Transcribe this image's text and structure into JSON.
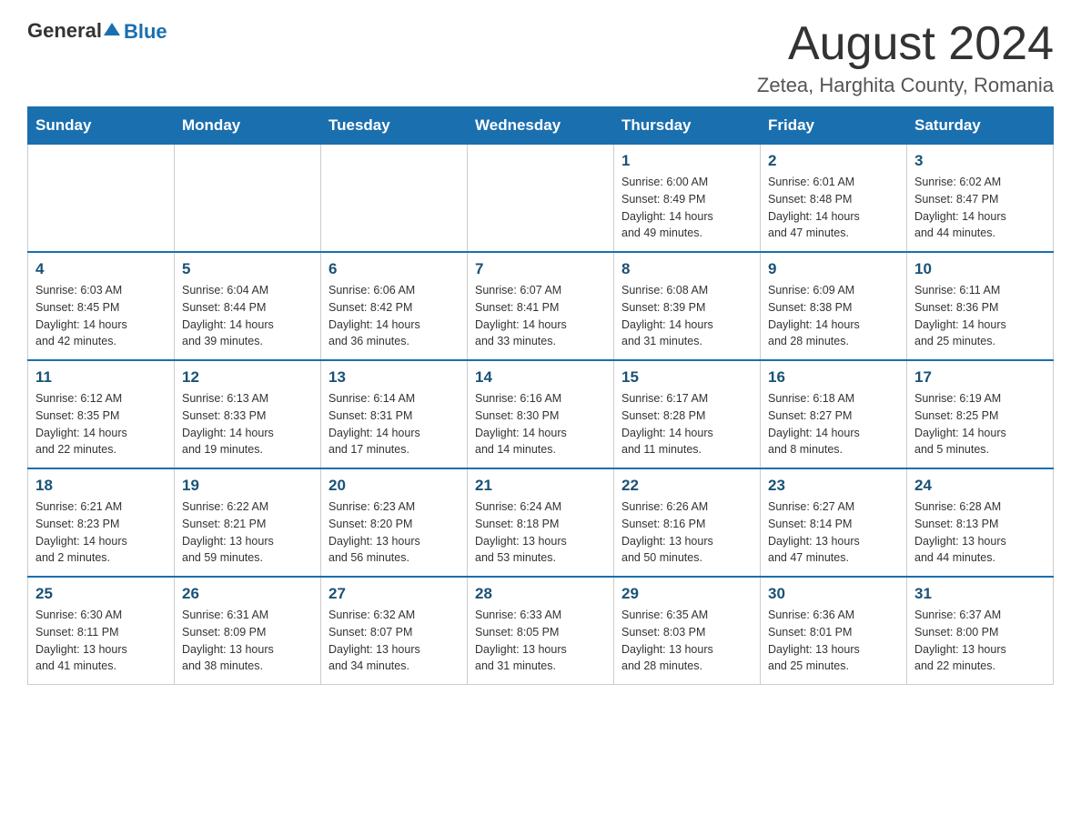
{
  "header": {
    "logo_general": "General",
    "logo_blue": "Blue",
    "month_title": "August 2024",
    "location": "Zetea, Harghita County, Romania"
  },
  "weekdays": [
    "Sunday",
    "Monday",
    "Tuesday",
    "Wednesday",
    "Thursday",
    "Friday",
    "Saturday"
  ],
  "weeks": [
    [
      {
        "day": "",
        "info": ""
      },
      {
        "day": "",
        "info": ""
      },
      {
        "day": "",
        "info": ""
      },
      {
        "day": "",
        "info": ""
      },
      {
        "day": "1",
        "info": "Sunrise: 6:00 AM\nSunset: 8:49 PM\nDaylight: 14 hours\nand 49 minutes."
      },
      {
        "day": "2",
        "info": "Sunrise: 6:01 AM\nSunset: 8:48 PM\nDaylight: 14 hours\nand 47 minutes."
      },
      {
        "day": "3",
        "info": "Sunrise: 6:02 AM\nSunset: 8:47 PM\nDaylight: 14 hours\nand 44 minutes."
      }
    ],
    [
      {
        "day": "4",
        "info": "Sunrise: 6:03 AM\nSunset: 8:45 PM\nDaylight: 14 hours\nand 42 minutes."
      },
      {
        "day": "5",
        "info": "Sunrise: 6:04 AM\nSunset: 8:44 PM\nDaylight: 14 hours\nand 39 minutes."
      },
      {
        "day": "6",
        "info": "Sunrise: 6:06 AM\nSunset: 8:42 PM\nDaylight: 14 hours\nand 36 minutes."
      },
      {
        "day": "7",
        "info": "Sunrise: 6:07 AM\nSunset: 8:41 PM\nDaylight: 14 hours\nand 33 minutes."
      },
      {
        "day": "8",
        "info": "Sunrise: 6:08 AM\nSunset: 8:39 PM\nDaylight: 14 hours\nand 31 minutes."
      },
      {
        "day": "9",
        "info": "Sunrise: 6:09 AM\nSunset: 8:38 PM\nDaylight: 14 hours\nand 28 minutes."
      },
      {
        "day": "10",
        "info": "Sunrise: 6:11 AM\nSunset: 8:36 PM\nDaylight: 14 hours\nand 25 minutes."
      }
    ],
    [
      {
        "day": "11",
        "info": "Sunrise: 6:12 AM\nSunset: 8:35 PM\nDaylight: 14 hours\nand 22 minutes."
      },
      {
        "day": "12",
        "info": "Sunrise: 6:13 AM\nSunset: 8:33 PM\nDaylight: 14 hours\nand 19 minutes."
      },
      {
        "day": "13",
        "info": "Sunrise: 6:14 AM\nSunset: 8:31 PM\nDaylight: 14 hours\nand 17 minutes."
      },
      {
        "day": "14",
        "info": "Sunrise: 6:16 AM\nSunset: 8:30 PM\nDaylight: 14 hours\nand 14 minutes."
      },
      {
        "day": "15",
        "info": "Sunrise: 6:17 AM\nSunset: 8:28 PM\nDaylight: 14 hours\nand 11 minutes."
      },
      {
        "day": "16",
        "info": "Sunrise: 6:18 AM\nSunset: 8:27 PM\nDaylight: 14 hours\nand 8 minutes."
      },
      {
        "day": "17",
        "info": "Sunrise: 6:19 AM\nSunset: 8:25 PM\nDaylight: 14 hours\nand 5 minutes."
      }
    ],
    [
      {
        "day": "18",
        "info": "Sunrise: 6:21 AM\nSunset: 8:23 PM\nDaylight: 14 hours\nand 2 minutes."
      },
      {
        "day": "19",
        "info": "Sunrise: 6:22 AM\nSunset: 8:21 PM\nDaylight: 13 hours\nand 59 minutes."
      },
      {
        "day": "20",
        "info": "Sunrise: 6:23 AM\nSunset: 8:20 PM\nDaylight: 13 hours\nand 56 minutes."
      },
      {
        "day": "21",
        "info": "Sunrise: 6:24 AM\nSunset: 8:18 PM\nDaylight: 13 hours\nand 53 minutes."
      },
      {
        "day": "22",
        "info": "Sunrise: 6:26 AM\nSunset: 8:16 PM\nDaylight: 13 hours\nand 50 minutes."
      },
      {
        "day": "23",
        "info": "Sunrise: 6:27 AM\nSunset: 8:14 PM\nDaylight: 13 hours\nand 47 minutes."
      },
      {
        "day": "24",
        "info": "Sunrise: 6:28 AM\nSunset: 8:13 PM\nDaylight: 13 hours\nand 44 minutes."
      }
    ],
    [
      {
        "day": "25",
        "info": "Sunrise: 6:30 AM\nSunset: 8:11 PM\nDaylight: 13 hours\nand 41 minutes."
      },
      {
        "day": "26",
        "info": "Sunrise: 6:31 AM\nSunset: 8:09 PM\nDaylight: 13 hours\nand 38 minutes."
      },
      {
        "day": "27",
        "info": "Sunrise: 6:32 AM\nSunset: 8:07 PM\nDaylight: 13 hours\nand 34 minutes."
      },
      {
        "day": "28",
        "info": "Sunrise: 6:33 AM\nSunset: 8:05 PM\nDaylight: 13 hours\nand 31 minutes."
      },
      {
        "day": "29",
        "info": "Sunrise: 6:35 AM\nSunset: 8:03 PM\nDaylight: 13 hours\nand 28 minutes."
      },
      {
        "day": "30",
        "info": "Sunrise: 6:36 AM\nSunset: 8:01 PM\nDaylight: 13 hours\nand 25 minutes."
      },
      {
        "day": "31",
        "info": "Sunrise: 6:37 AM\nSunset: 8:00 PM\nDaylight: 13 hours\nand 22 minutes."
      }
    ]
  ]
}
